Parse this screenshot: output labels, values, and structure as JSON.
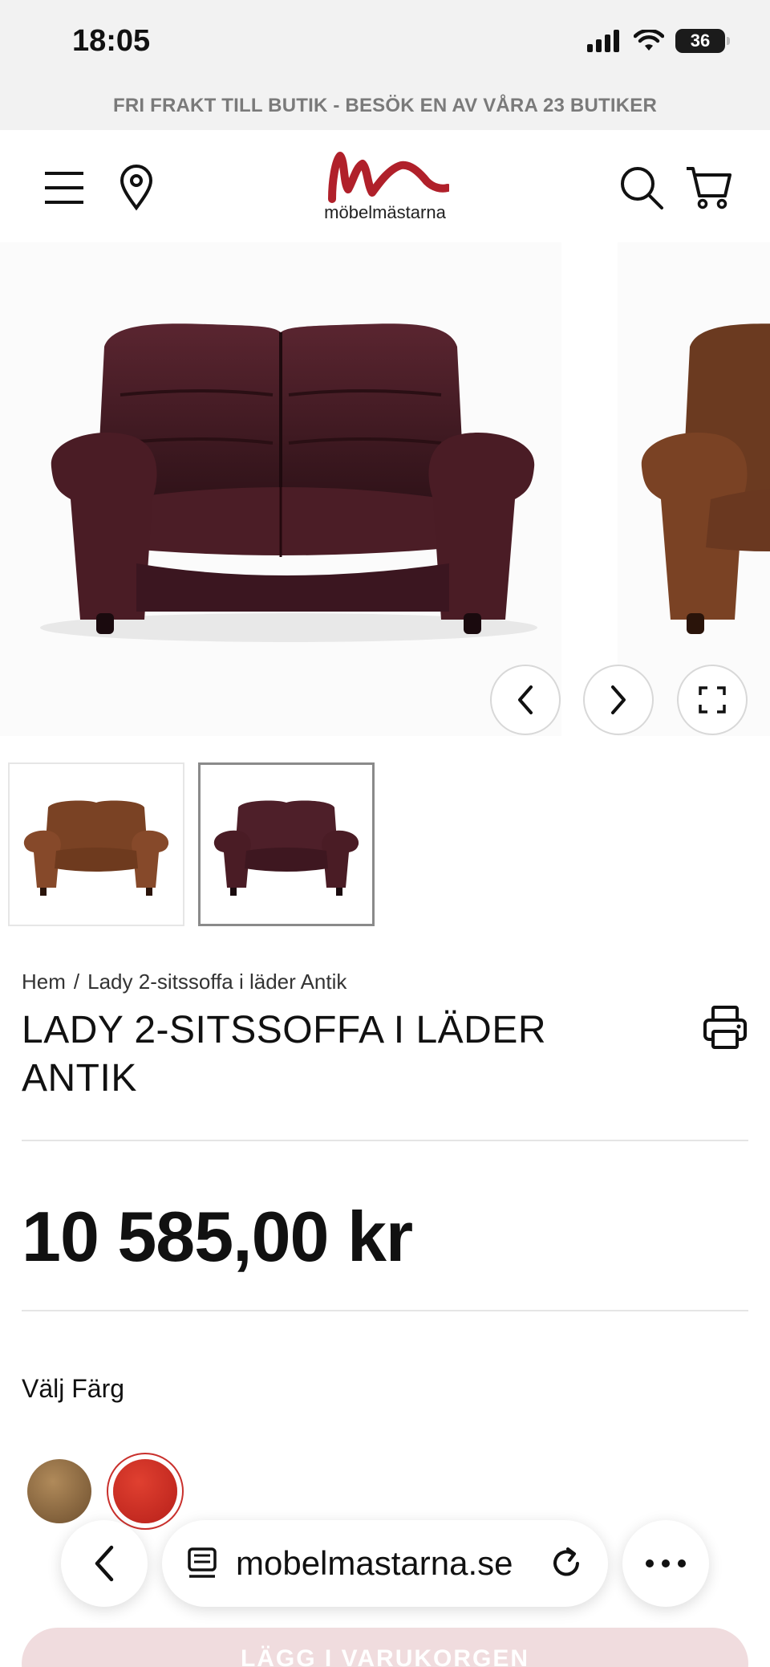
{
  "status_bar": {
    "time": "18:05",
    "battery": "36",
    "icons": [
      "signal-icon",
      "wifi-icon",
      "battery-icon"
    ]
  },
  "promo": {
    "text": "FRI FRAKT TILL BUTIK - BESÖK EN AV VÅRA 23 BUTIKER"
  },
  "header": {
    "logo_text": "möbelmästarna",
    "icons": [
      "menu-icon",
      "location-pin-icon",
      "search-icon",
      "cart-icon"
    ],
    "brand_color": "#b0202a"
  },
  "gallery": {
    "controls": [
      "chevron-left-icon",
      "chevron-right-icon",
      "fullscreen-icon"
    ],
    "thumbnail_count": 2,
    "active_thumbnail": 2
  },
  "breadcrumb": {
    "items": [
      "Hem",
      "Lady 2-sitssoffa i läder Antik"
    ],
    "separator": "/"
  },
  "product": {
    "title": "LADY 2-SITSSOFFA I LÄDER ANTIK",
    "price": "10 585,00 kr",
    "color_label": "Välj Färg",
    "swatches": [
      {
        "name": "brown",
        "color": "#8a6a45"
      },
      {
        "name": "red",
        "color": "#cc2b22",
        "selected": true
      }
    ]
  },
  "browser": {
    "url": "mobelmastarna.se",
    "icons": [
      "back-icon",
      "reader-icon",
      "reload-icon",
      "more-icon"
    ]
  },
  "cta": {
    "label": "LÄGG I VARUKORGEN"
  }
}
